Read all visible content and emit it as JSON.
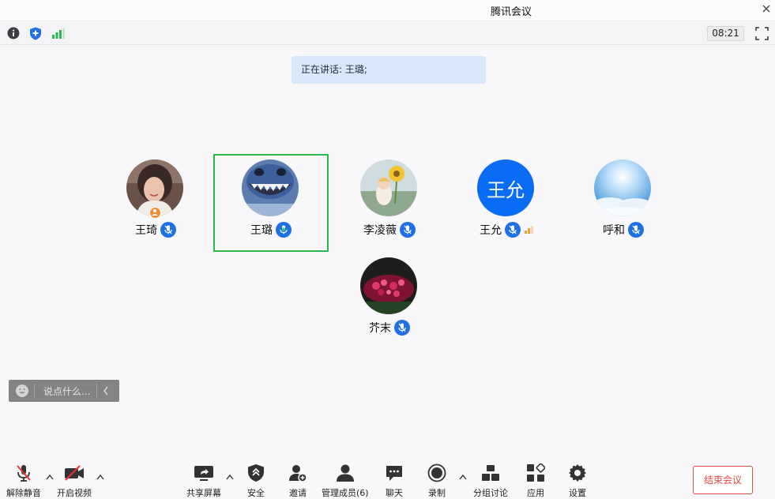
{
  "window": {
    "title": "腾讯会议"
  },
  "topbar": {
    "icons": [
      "info-icon",
      "shield-icon",
      "signal-icon"
    ],
    "timer": "08:21",
    "fullscreen_icon": "fullscreen-icon"
  },
  "speaking": {
    "text": "正在讲话: 王璐;"
  },
  "participants": [
    {
      "name": "王琦",
      "mic": "muted",
      "host": true
    },
    {
      "name": "王璐",
      "mic": "speaking",
      "active": true
    },
    {
      "name": "李凌薇",
      "mic": "muted"
    },
    {
      "name": "王允",
      "mic": "muted",
      "avatar_text": "王允",
      "avatar_color": "#0a6cf5",
      "signal": "weak"
    },
    {
      "name": "呼和",
      "mic": "muted"
    },
    {
      "name": "芥末",
      "mic": "muted"
    }
  ],
  "chat": {
    "placeholder": "说点什么..."
  },
  "toolbar": {
    "unmute": "解除静音",
    "video": "开启视频",
    "share": "共享屏幕",
    "security": "安全",
    "invite": "邀请",
    "members": "管理成员(6)",
    "chat": "聊天",
    "record": "录制",
    "breakout": "分组讨论",
    "apps": "应用",
    "settings": "设置",
    "end": "结束会议"
  },
  "colors": {
    "accent": "#1f6fe5",
    "speaking_border": "#2cb652",
    "end_red": "#e04848",
    "banner_bg": "#d8e8fb"
  }
}
